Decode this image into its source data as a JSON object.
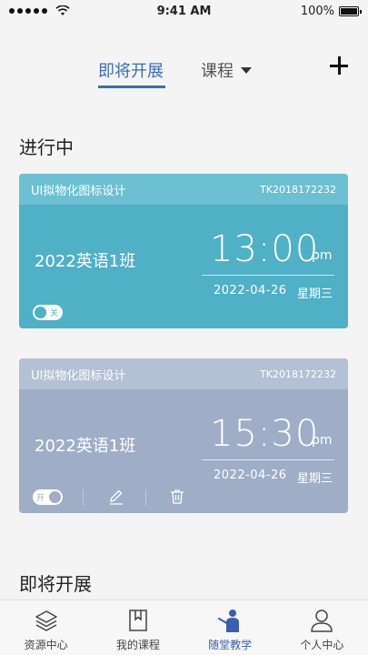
{
  "status_bar": {
    "time": "9:41 AM",
    "battery": "100%"
  },
  "nav": {
    "tab_upcoming": "即将开展",
    "tab_courses": "课程"
  },
  "sections": {
    "in_progress": "进行中",
    "upcoming": "即将开展"
  },
  "cards": [
    {
      "title": "UI拟物化图标设计",
      "code": "TK2018172232",
      "class_name": "2022英语1班",
      "time": "13:00",
      "ampm": "pm",
      "date": "2022-04-26",
      "weekday": "星期三",
      "toggle_label": "关",
      "toggle_on": false,
      "color": "#4fb0c6"
    },
    {
      "title": "UI拟物化图标设计",
      "code": "TK2018172232",
      "class_name": "2022英语1班",
      "time": "15:30",
      "ampm": "pm",
      "date": "2022-04-26",
      "weekday": "星期三",
      "toggle_label": "开",
      "toggle_on": true,
      "color": "#9fadc7"
    }
  ],
  "tab_bar": [
    {
      "label": "资源中心",
      "icon": "layers-icon"
    },
    {
      "label": "我的课程",
      "icon": "book-icon"
    },
    {
      "label": "随堂教学",
      "icon": "teacher-icon",
      "active": true
    },
    {
      "label": "个人中心",
      "icon": "user-icon"
    }
  ],
  "colors": {
    "accent": "#3a6db5",
    "card_active": "#4fb0c6",
    "card_inactive": "#9fadc7",
    "tab_active": "#3a5fb0"
  }
}
